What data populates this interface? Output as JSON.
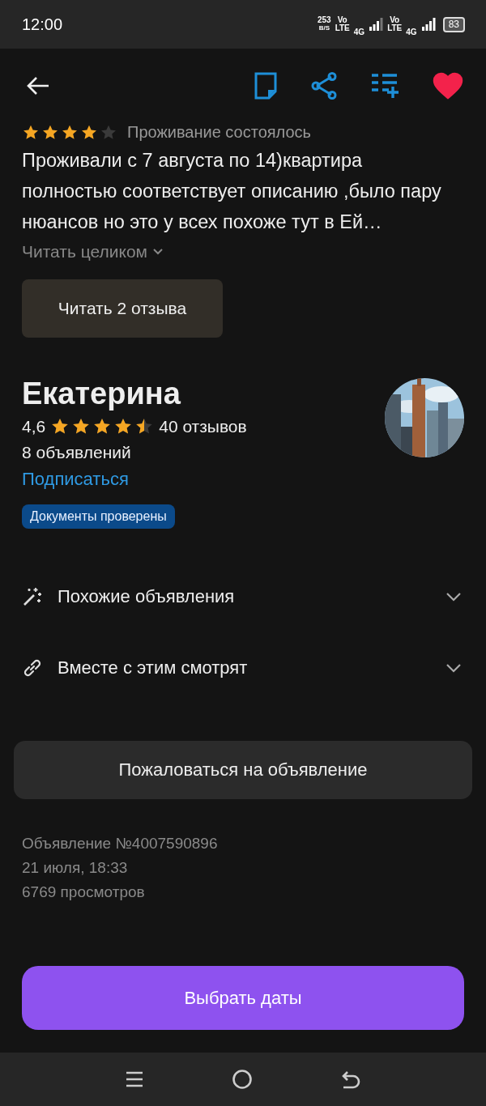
{
  "status_bar": {
    "time": "12:00",
    "speed": "253",
    "speed_unit": "B/S",
    "sim_1": {
      "volte_top": "Vo",
      "volte_bottom": "LTE",
      "network": "4G"
    },
    "sim_2": {
      "volte_top": "Vo",
      "volte_bottom": "LTE",
      "network": "4G"
    },
    "battery": "83"
  },
  "header": {
    "favorite": true
  },
  "review": {
    "stars": 4,
    "status": "Проживание состоялось",
    "text": "Проживали с 7 августа по 14)квартира полностью соответствует описанию ,было пару нюансов но это у всех похоже тут в Ей…",
    "read_more": "Читать целиком",
    "all_reviews_button": "Читать 2 отзыва"
  },
  "seller": {
    "name": "Екатерина",
    "rating": "4,6",
    "stars": 4.5,
    "reviews": "40 отзывов",
    "listings": "8 объявлений",
    "subscribe": "Подписаться",
    "badge": "Документы проверены"
  },
  "sections": [
    {
      "kind": "similar",
      "label": "Похожие объявления",
      "expanded": false
    },
    {
      "kind": "related",
      "label": "Вместе с этим смотрят",
      "expanded": false
    }
  ],
  "report_button": "Пожаловаться на объявление",
  "meta": [
    "Объявление №4007590896",
    "21 июля, 18:33",
    "6769 просмотров"
  ],
  "cta_button": "Выбрать даты"
}
